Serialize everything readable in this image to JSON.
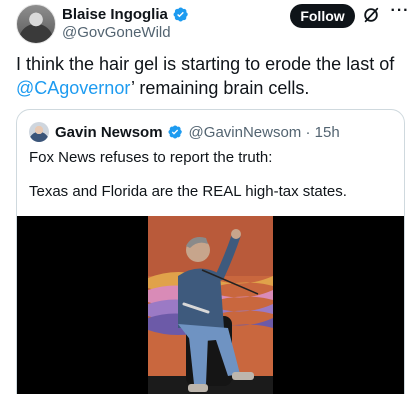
{
  "author": {
    "display_name": "Blaise Ingoglia",
    "handle": "@GovGoneWild",
    "avatar_icon": "person-avatar"
  },
  "actions": {
    "follow_label": "Follow",
    "grok_icon": "grok-icon",
    "more_label": "···"
  },
  "tweet": {
    "text_before": "I think the hair gel is starting to erode the last of ",
    "mention": "@CAgovernor",
    "text_after": "’ remaining brain cells."
  },
  "quote": {
    "display_name": "Gavin Newsom",
    "handle_time": "@GavinNewsom · 15h",
    "line1": "Fox News refuses to report the truth:",
    "line2": "Texas and Florida are the REAL high-tax states."
  },
  "colors": {
    "accent": "#1d9bf0",
    "verified": "#1d9bf0",
    "text": "#0f1419",
    "muted": "#536471"
  }
}
